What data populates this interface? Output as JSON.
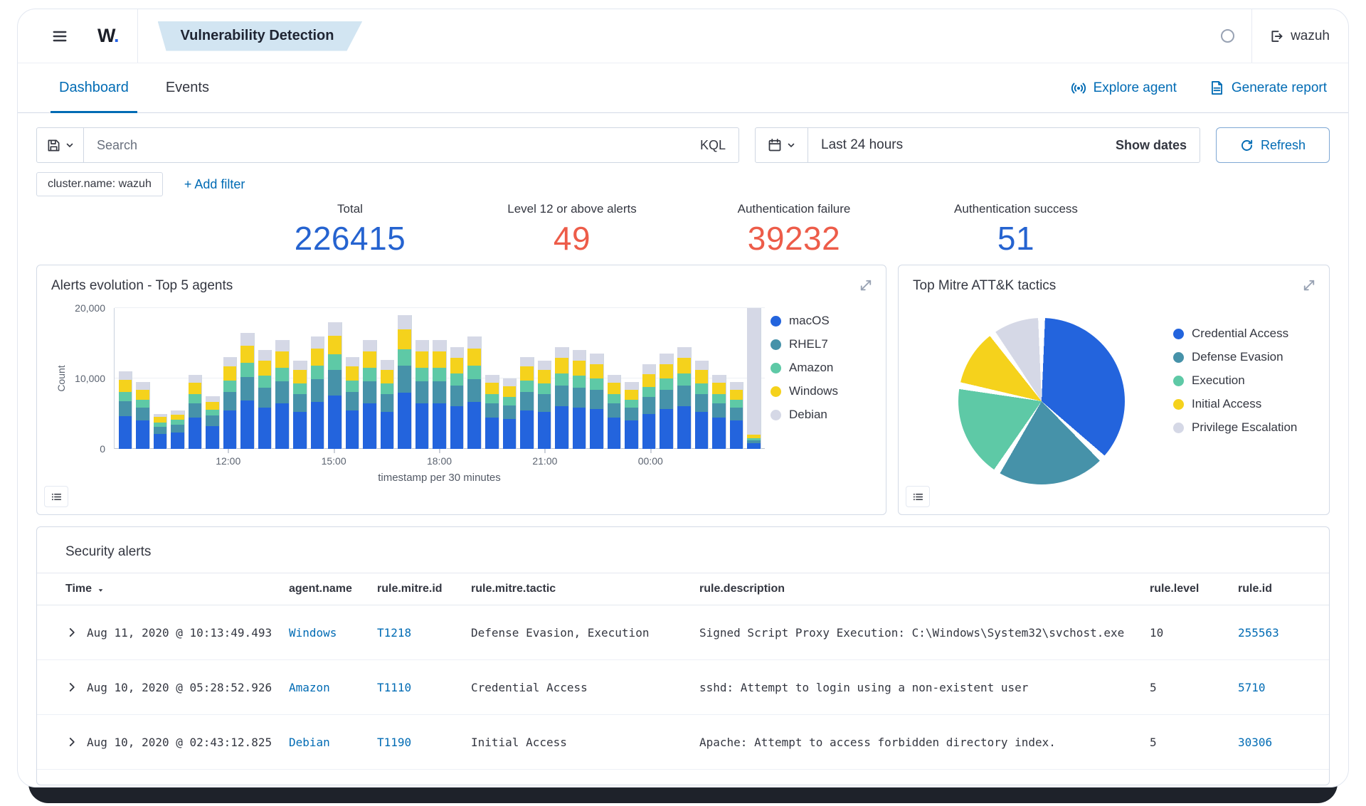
{
  "header": {
    "logo_w": "W",
    "logo_dot": ".",
    "breadcrumb": "Vulnerability Detection",
    "brand": "wazuh"
  },
  "tabs": {
    "dashboard": "Dashboard",
    "events": "Events",
    "explore_agent": "Explore agent",
    "generate_report": "Generate report"
  },
  "search_bar": {
    "placeholder": "Search",
    "kql_label": "KQL",
    "time_range": "Last 24 hours",
    "show_dates_label": "Show dates",
    "refresh_label": "Refresh"
  },
  "filters": {
    "pill": "cluster.name: wazuh",
    "add_filter_label": "+ Add filter"
  },
  "stats": [
    {
      "label": "Total",
      "value": "226415",
      "color": "#2563d0"
    },
    {
      "label": "Level 12 or above alerts",
      "value": "49",
      "color": "#ed5c49"
    },
    {
      "label": "Authentication failure",
      "value": "39232",
      "color": "#ed5c49"
    },
    {
      "label": "Authentication success",
      "value": "51",
      "color": "#2563d0"
    }
  ],
  "panels": {
    "alerts_evolution": {
      "title": "Alerts evolution - Top 5 agents"
    },
    "mitre": {
      "title": "Top Mitre ATT&K tactics"
    },
    "security_alerts": {
      "title": "Security alerts"
    }
  },
  "chart_data": [
    {
      "type": "bar",
      "stacked": true,
      "title": "Alerts evolution - Top 5 agents",
      "xlabel": "timestamp per 30 minutes",
      "ylabel": "Count",
      "ylim": [
        0,
        20000
      ],
      "yticks": [
        "0",
        "10,000",
        "20,000"
      ],
      "grid": true,
      "legend_position": "right",
      "x": [
        "09:00",
        "09:30",
        "10:00",
        "10:30",
        "11:00",
        "11:30",
        "12:00",
        "12:30",
        "13:00",
        "13:30",
        "14:00",
        "14:30",
        "15:00",
        "15:30",
        "16:00",
        "16:30",
        "17:00",
        "17:30",
        "18:00",
        "18:30",
        "19:00",
        "19:30",
        "20:00",
        "20:30",
        "21:00",
        "21:30",
        "22:00",
        "22:30",
        "23:00",
        "23:30",
        "00:00",
        "00:30",
        "01:00",
        "01:30",
        "02:00",
        "02:30",
        "03:00"
      ],
      "x_ticks": [
        "12:00",
        "15:00",
        "18:00",
        "21:00",
        "00:00"
      ],
      "series": [
        {
          "name": "macOS",
          "color": "#2364dd",
          "values": [
            4600,
            4000,
            2100,
            2300,
            4400,
            3200,
            5500,
            6900,
            5900,
            6500,
            5300,
            6700,
            7600,
            5500,
            6500,
            5300,
            8000,
            6500,
            6500,
            6100,
            6700,
            4400,
            4200,
            5500,
            5300,
            6100,
            5900,
            5700,
            4400,
            4000,
            5000,
            5700,
            6100,
            5300,
            4400,
            4000,
            800
          ]
        },
        {
          "name": "RHEL7",
          "color": "#4692a9",
          "values": [
            2200,
            1900,
            1000,
            1100,
            2100,
            1500,
            2600,
            3300,
            2800,
            3100,
            2500,
            3200,
            3600,
            2600,
            3100,
            2500,
            3800,
            3100,
            3100,
            2900,
            3200,
            2100,
            2000,
            2600,
            2500,
            2900,
            2800,
            2700,
            2100,
            1900,
            2400,
            2700,
            2900,
            2500,
            2100,
            1900,
            400
          ]
        },
        {
          "name": "Amazon",
          "color": "#5ec9a6",
          "values": [
            1300,
            1100,
            600,
            700,
            1300,
            900,
            1600,
            2000,
            1700,
            1900,
            1500,
            1900,
            2200,
            1600,
            1900,
            1500,
            2300,
            1900,
            1900,
            1700,
            1900,
            1300,
            1200,
            1600,
            1500,
            1700,
            1700,
            1600,
            1300,
            1100,
            1400,
            1600,
            1700,
            1500,
            1300,
            1100,
            300
          ]
        },
        {
          "name": "Windows",
          "color": "#f5d21c",
          "values": [
            1700,
            1400,
            800,
            800,
            1600,
            1100,
            2000,
            2500,
            2100,
            2300,
            1900,
            2400,
            2700,
            2000,
            2300,
            1900,
            2900,
            2300,
            2300,
            2200,
            2400,
            1600,
            1500,
            2000,
            1900,
            2200,
            2100,
            2000,
            1600,
            1400,
            1800,
            2000,
            2200,
            1900,
            1600,
            1400,
            500
          ]
        },
        {
          "name": "Debian",
          "color": "#d5d8e6",
          "values": [
            1200,
            1100,
            500,
            600,
            1100,
            800,
            1300,
            1800,
            1500,
            1700,
            1300,
            1800,
            1900,
            1300,
            1700,
            1400,
            2000,
            1700,
            1700,
            1600,
            1800,
            1100,
            1100,
            1300,
            1300,
            1600,
            1500,
            1500,
            1100,
            1100,
            1400,
            1500,
            1600,
            1300,
            1100,
            1100,
            18000
          ]
        }
      ]
    },
    {
      "type": "pie",
      "title": "Top Mitre ATT&K tactics",
      "labels": [
        "Credential Access",
        "Defense Evasion",
        "Execution",
        "Initial Access",
        "Privilege Escalation"
      ],
      "values": [
        37,
        22,
        19,
        12,
        10
      ],
      "colors": [
        "#2364dd",
        "#4692a9",
        "#5ec9a6",
        "#f5d21c",
        "#d5d8e6"
      ],
      "legend_position": "right"
    }
  ],
  "table": {
    "columns": [
      "Time",
      "agent.name",
      "rule.mitre.id",
      "rule.mitre.tactic",
      "rule.description",
      "rule.level",
      "rule.id"
    ],
    "rows": [
      {
        "time": "Aug 11, 2020 @ 10:13:49.493",
        "agent": "Windows",
        "mitre_id": "T1218",
        "tactic": "Defense Evasion, Execution",
        "description": "Signed Script Proxy Execution: C:\\Windows\\System32\\svchost.exe",
        "level": "10",
        "rule_id": "255563"
      },
      {
        "time": "Aug 10, 2020 @ 05:28:52.926",
        "agent": "Amazon",
        "mitre_id": "T1110",
        "tactic": "Credential Access",
        "description": "sshd: Attempt to login using a non-existent user",
        "level": "5",
        "rule_id": "5710"
      },
      {
        "time": "Aug 10, 2020 @ 02:43:12.825",
        "agent": "Debian",
        "mitre_id": "T1190",
        "tactic": "Initial Access",
        "description": "Apache: Attempt to access forbidden directory index.",
        "level": "5",
        "rule_id": "30306"
      }
    ]
  },
  "colors": {
    "link": "#006BB4",
    "text": "#343741",
    "border": "#d3dae6"
  }
}
